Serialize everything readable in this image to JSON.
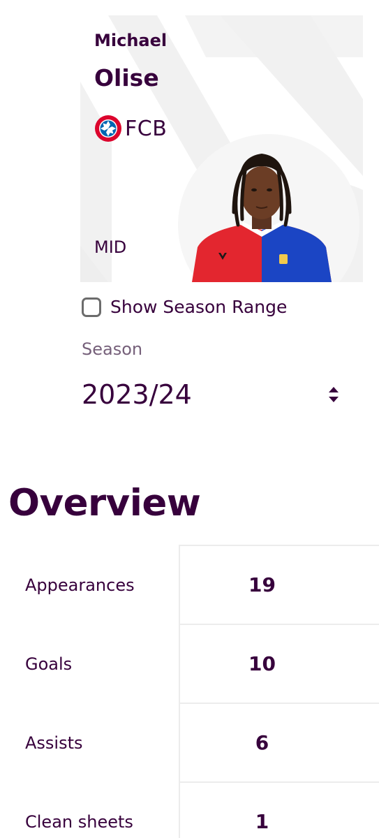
{
  "player": {
    "first_name": "Michael",
    "last_name": "Olise",
    "club_short": "FCB",
    "club_badge_icon": "fc-bayern-badge-icon",
    "position": "MID",
    "photo": "player-photo"
  },
  "season_range": {
    "label": "Show Season Range",
    "checked": false
  },
  "season": {
    "label": "Season",
    "value": "2023/24",
    "icon": "sort-arrows-icon"
  },
  "overview": {
    "title": "Overview",
    "stats": [
      {
        "label": "Appearances",
        "value": "19"
      },
      {
        "label": "Goals",
        "value": "10"
      },
      {
        "label": "Assists",
        "value": "6"
      },
      {
        "label": "Clean sheets",
        "value": "1"
      }
    ]
  },
  "colors": {
    "primary": "#37003c",
    "muted": "#76607a",
    "divider": "#ececec",
    "card_shape": "#efefef",
    "badge_red": "#dc052d",
    "badge_blue": "#0066b2",
    "kit_red": "#e3262f",
    "kit_blue": "#1b45c4"
  }
}
